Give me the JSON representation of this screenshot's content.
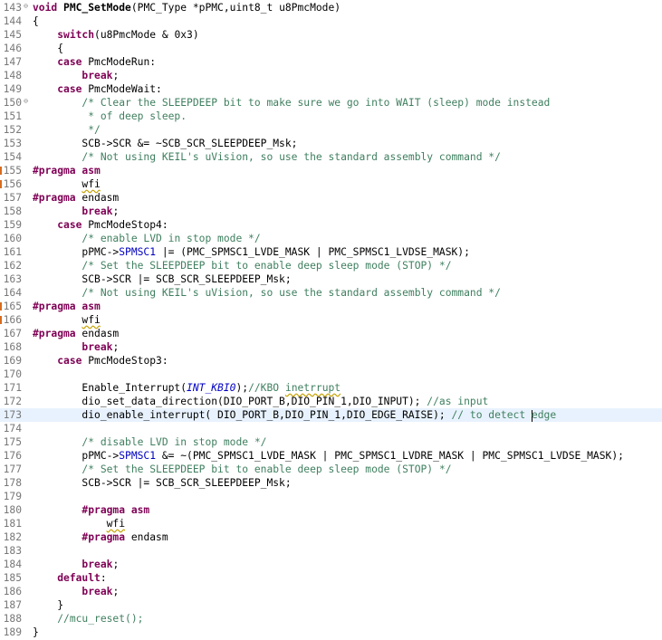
{
  "editor": {
    "lines": [
      {
        "n": "143",
        "fold": "⊖",
        "segs": [
          [
            "kw",
            "void "
          ],
          [
            "fn",
            "PMC_SetMode"
          ],
          [
            "",
            "(PMC_Type *pPMC,uint8_t u8PmcMode)"
          ]
        ]
      },
      {
        "n": "144",
        "segs": [
          [
            "",
            "{"
          ]
        ]
      },
      {
        "n": "145",
        "segs": [
          [
            "",
            "    "
          ],
          [
            "kw",
            "switch"
          ],
          [
            "",
            "(u8PmcMode & 0x3)"
          ]
        ]
      },
      {
        "n": "146",
        "segs": [
          [
            "",
            "    {"
          ]
        ]
      },
      {
        "n": "147",
        "segs": [
          [
            "",
            "    "
          ],
          [
            "kw",
            "case "
          ],
          [
            "",
            "PmcModeRun:"
          ]
        ]
      },
      {
        "n": "148",
        "segs": [
          [
            "",
            "        "
          ],
          [
            "kw",
            "break"
          ],
          [
            "",
            ";"
          ]
        ]
      },
      {
        "n": "149",
        "segs": [
          [
            "",
            "    "
          ],
          [
            "kw",
            "case "
          ],
          [
            "",
            "PmcModeWait:"
          ]
        ]
      },
      {
        "n": "150",
        "fold": "⊖",
        "segs": [
          [
            "",
            "        "
          ],
          [
            "cm",
            "/* Clear the SLEEPDEEP bit to make sure we go into WAIT (sleep) mode instead"
          ]
        ]
      },
      {
        "n": "151",
        "segs": [
          [
            "",
            "         "
          ],
          [
            "cm",
            "* of deep sleep."
          ]
        ]
      },
      {
        "n": "152",
        "segs": [
          [
            "",
            "         "
          ],
          [
            "cm",
            "*/"
          ]
        ]
      },
      {
        "n": "153",
        "segs": [
          [
            "",
            "        SCB->SCR &= ~SCB_SCR_SLEEPDEEP_Msk;"
          ]
        ]
      },
      {
        "n": "154",
        "segs": [
          [
            "",
            "        "
          ],
          [
            "cm",
            "/* Not using KEIL's uVision, so use the standard assembly command */"
          ]
        ]
      },
      {
        "n": "155",
        "marker": true,
        "segs": [
          [
            "pp",
            "#pragma asm"
          ]
        ]
      },
      {
        "n": "156",
        "marker": true,
        "segs": [
          [
            "",
            "        "
          ],
          [
            "sq",
            "wfi"
          ]
        ]
      },
      {
        "n": "157",
        "segs": [
          [
            "pp",
            "#pragma "
          ],
          [
            "",
            "endasm"
          ]
        ]
      },
      {
        "n": "158",
        "segs": [
          [
            "",
            "        "
          ],
          [
            "kw",
            "break"
          ],
          [
            "",
            ";"
          ]
        ]
      },
      {
        "n": "159",
        "segs": [
          [
            "",
            "    "
          ],
          [
            "kw",
            "case "
          ],
          [
            "",
            "PmcModeStop4:"
          ]
        ]
      },
      {
        "n": "160",
        "segs": [
          [
            "",
            "        "
          ],
          [
            "cm",
            "/* enable LVD in stop mode */"
          ]
        ]
      },
      {
        "n": "161",
        "segs": [
          [
            "",
            "        pPMC->"
          ],
          [
            "fld",
            "SPMSC1"
          ],
          [
            "",
            " |= (PMC_SPMSC1_LVDE_MASK | PMC_SPMSC1_LVDSE_MASK);"
          ]
        ]
      },
      {
        "n": "162",
        "segs": [
          [
            "",
            "        "
          ],
          [
            "cm",
            "/* Set the SLEEPDEEP bit to enable deep sleep mode (STOP) */"
          ]
        ]
      },
      {
        "n": "163",
        "segs": [
          [
            "",
            "        SCB->SCR |= SCB_SCR_SLEEPDEEP_Msk;"
          ]
        ]
      },
      {
        "n": "164",
        "segs": [
          [
            "",
            "        "
          ],
          [
            "cm",
            "/* Not using KEIL's uVision, so use the standard assembly command */"
          ]
        ]
      },
      {
        "n": "165",
        "marker": true,
        "segs": [
          [
            "pp",
            "#pragma asm"
          ]
        ]
      },
      {
        "n": "166",
        "marker": true,
        "segs": [
          [
            "",
            "        "
          ],
          [
            "sq",
            "wfi"
          ]
        ]
      },
      {
        "n": "167",
        "segs": [
          [
            "pp",
            "#pragma "
          ],
          [
            "",
            "endasm"
          ]
        ]
      },
      {
        "n": "168",
        "segs": [
          [
            "",
            "        "
          ],
          [
            "kw",
            "break"
          ],
          [
            "",
            ";"
          ]
        ]
      },
      {
        "n": "169",
        "segs": [
          [
            "",
            "    "
          ],
          [
            "kw",
            "case "
          ],
          [
            "",
            "PmcModeStop3:"
          ]
        ]
      },
      {
        "n": "170",
        "segs": []
      },
      {
        "n": "171",
        "segs": [
          [
            "",
            "        Enable_Interrupt("
          ],
          [
            "it",
            "INT_KBI0"
          ],
          [
            "",
            ");"
          ],
          [
            "cm",
            "//KBO "
          ],
          [
            "sq cm",
            "inetrrupt"
          ]
        ]
      },
      {
        "n": "172",
        "segs": [
          [
            "",
            "        dio_set_data_direction(DIO_PORT_B,DIO_PIN_1,DIO_INPUT); "
          ],
          [
            "cm",
            "//as input"
          ]
        ]
      },
      {
        "n": "173",
        "current": true,
        "segs": [
          [
            "",
            "        dio_enable_interrupt( DIO_PORT_B,DIO_PIN_1,DIO_EDGE_RAISE); "
          ],
          [
            "cm",
            "// to detect "
          ],
          [
            "caret",
            ""
          ],
          [
            "cm",
            "edge"
          ]
        ]
      },
      {
        "n": "174",
        "segs": []
      },
      {
        "n": "175",
        "segs": [
          [
            "",
            "        "
          ],
          [
            "cm",
            "/* disable LVD in stop mode */"
          ]
        ]
      },
      {
        "n": "176",
        "segs": [
          [
            "",
            "        pPMC->"
          ],
          [
            "fld",
            "SPMSC1"
          ],
          [
            "",
            " &= ~(PMC_SPMSC1_LVDE_MASK | PMC_SPMSC1_LVDRE_MASK | PMC_SPMSC1_LVDSE_MASK);"
          ]
        ]
      },
      {
        "n": "177",
        "segs": [
          [
            "",
            "        "
          ],
          [
            "cm",
            "/* Set the SLEEPDEEP bit to enable deep sleep mode (STOP) */"
          ]
        ]
      },
      {
        "n": "178",
        "segs": [
          [
            "",
            "        SCB->SCR |= SCB_SCR_SLEEPDEEP_Msk;"
          ]
        ]
      },
      {
        "n": "179",
        "segs": []
      },
      {
        "n": "180",
        "segs": [
          [
            "",
            "        "
          ],
          [
            "pp",
            "#pragma asm"
          ]
        ]
      },
      {
        "n": "181",
        "segs": [
          [
            "",
            "            "
          ],
          [
            "sq",
            "wfi"
          ]
        ]
      },
      {
        "n": "182",
        "segs": [
          [
            "",
            "        "
          ],
          [
            "pp",
            "#pragma "
          ],
          [
            "",
            "endasm"
          ]
        ]
      },
      {
        "n": "183",
        "segs": []
      },
      {
        "n": "184",
        "segs": [
          [
            "",
            "        "
          ],
          [
            "kw",
            "break"
          ],
          [
            "",
            ";"
          ]
        ]
      },
      {
        "n": "185",
        "segs": [
          [
            "",
            "    "
          ],
          [
            "kw",
            "default"
          ],
          [
            "",
            ":"
          ]
        ]
      },
      {
        "n": "186",
        "segs": [
          [
            "",
            "        "
          ],
          [
            "kw",
            "break"
          ],
          [
            "",
            ";"
          ]
        ]
      },
      {
        "n": "187",
        "segs": [
          [
            "",
            "    }"
          ]
        ]
      },
      {
        "n": "188",
        "segs": [
          [
            "",
            "    "
          ],
          [
            "cm",
            "//mcu_reset();"
          ]
        ]
      },
      {
        "n": "189",
        "segs": [
          [
            "",
            "}"
          ]
        ]
      }
    ]
  }
}
